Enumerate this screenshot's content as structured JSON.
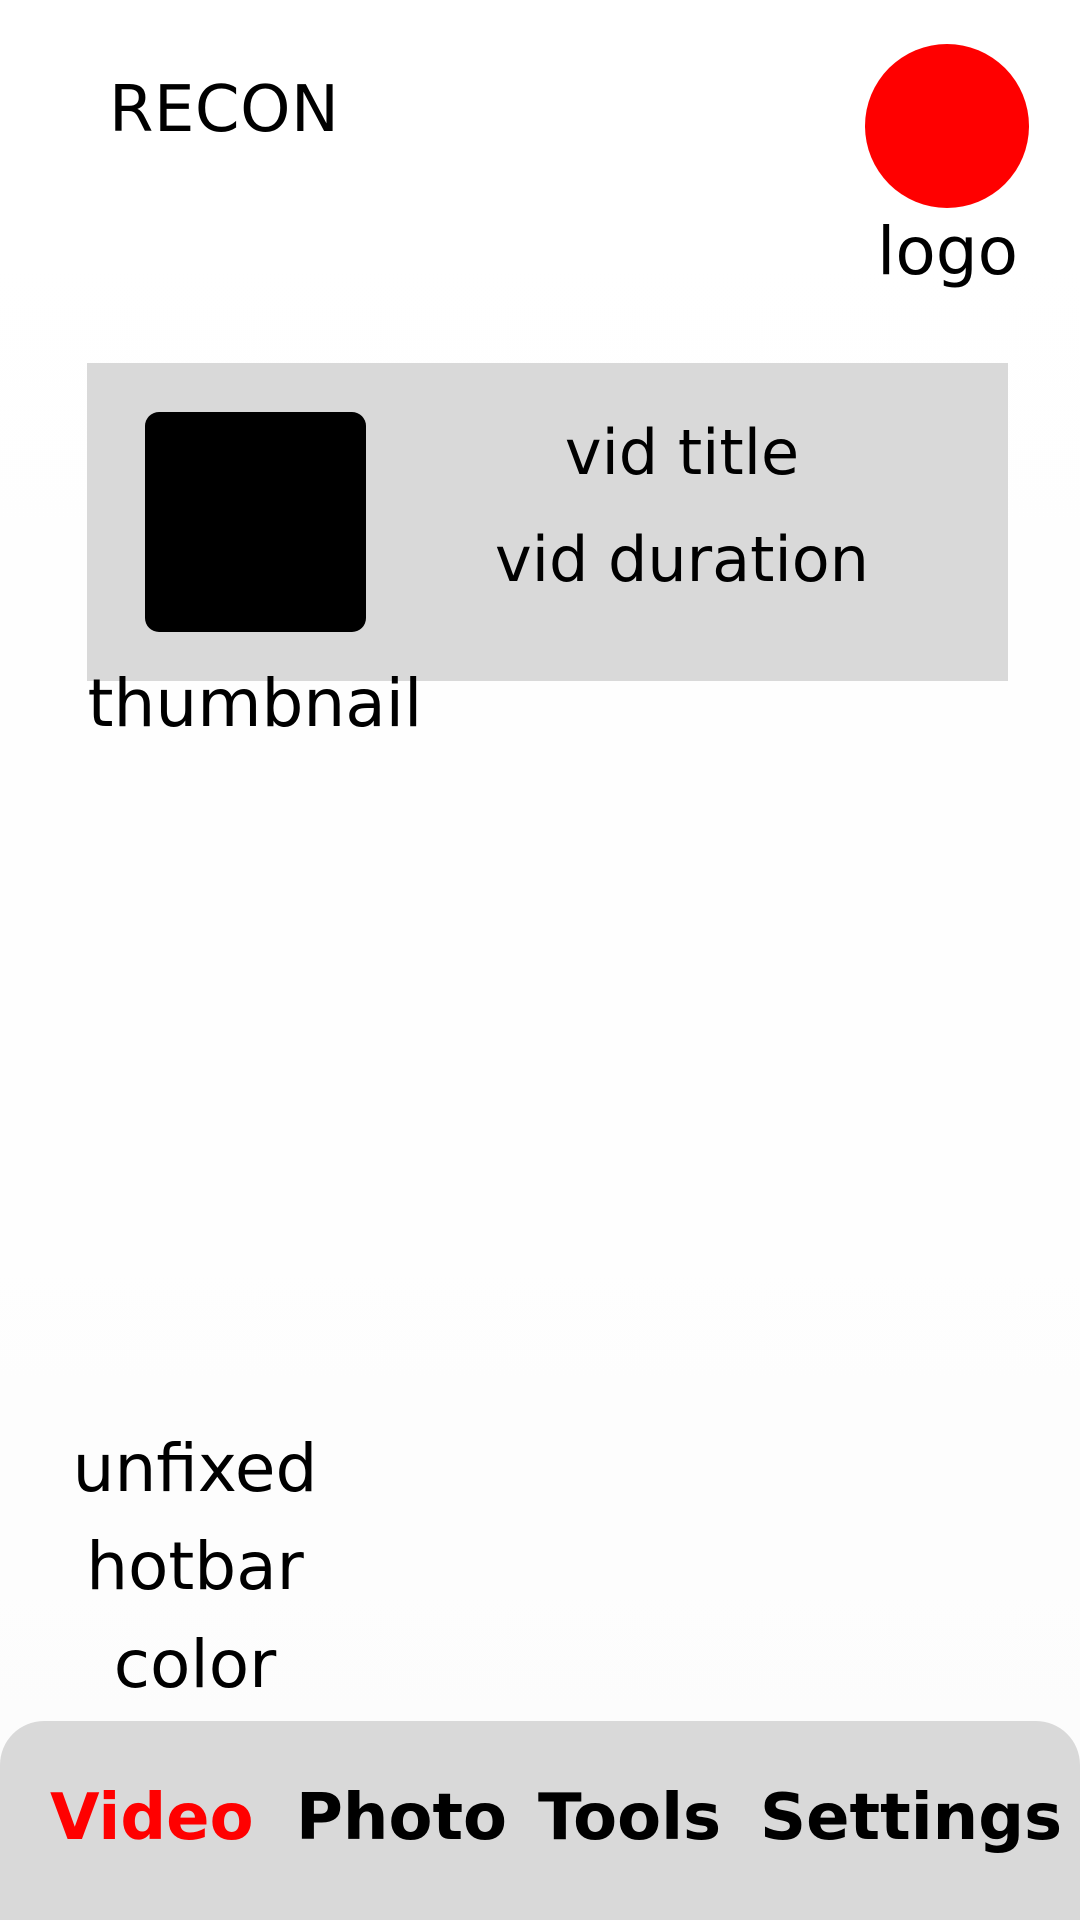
{
  "header": {
    "app_title": "RECON",
    "logo_label": "logo",
    "logo_color": "#ff0000"
  },
  "video_card": {
    "title": "vid title",
    "duration": "vid duration",
    "thumbnail_label": "thumbnail",
    "background": "#d9d9d9",
    "thumbnail_color": "#000000"
  },
  "note": {
    "lines": [
      "unfixed",
      "hotbar",
      "color"
    ]
  },
  "hotbar": {
    "background": "#d9d9d9",
    "active_color": "#ff0000",
    "items": [
      {
        "label": "Video",
        "active": true
      },
      {
        "label": "Photo",
        "active": false
      },
      {
        "label": "Tools",
        "active": false
      },
      {
        "label": "Settings",
        "active": false
      }
    ]
  }
}
